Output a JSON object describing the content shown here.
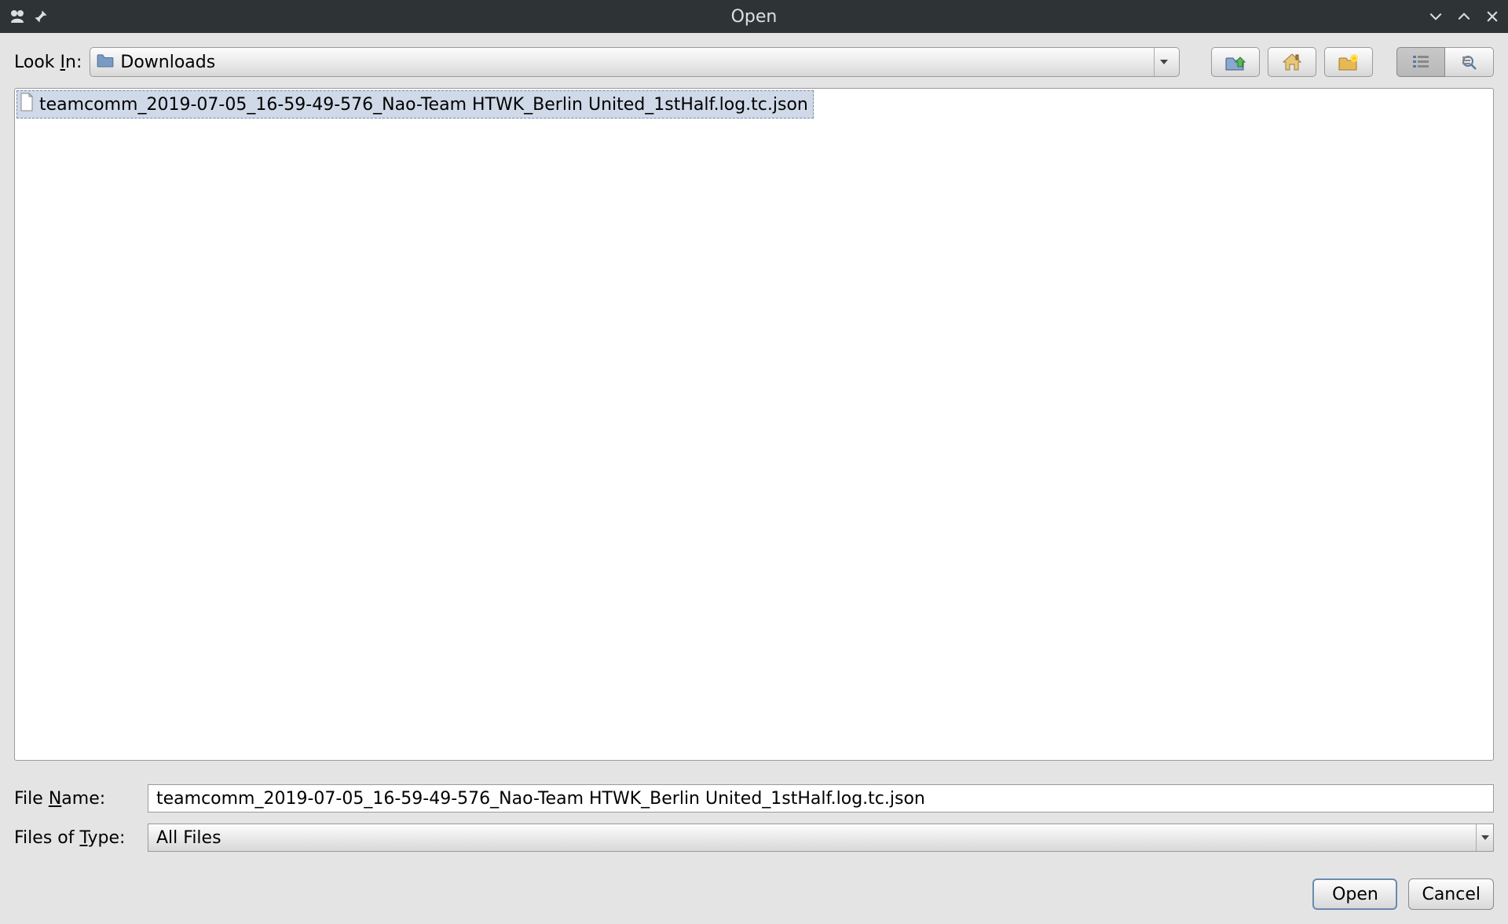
{
  "titlebar": {
    "title": "Open"
  },
  "lookin": {
    "label_pre": "Look ",
    "label_u": "I",
    "label_post": "n:",
    "folder": "Downloads"
  },
  "files": [
    {
      "name": "teamcomm_2019-07-05_16-59-49-576_Nao-Team HTWK_Berlin United_1stHalf.log.tc.json",
      "selected": true
    }
  ],
  "filename": {
    "label_pre": "File ",
    "label_u": "N",
    "label_post": "ame:",
    "value": "teamcomm_2019-07-05_16-59-49-576_Nao-Team HTWK_Berlin United_1stHalf.log.tc.json"
  },
  "filetype": {
    "label_pre": "Files of ",
    "label_u": "T",
    "label_post": "ype:",
    "value": "All Files"
  },
  "buttons": {
    "open": "Open",
    "cancel": "Cancel"
  }
}
